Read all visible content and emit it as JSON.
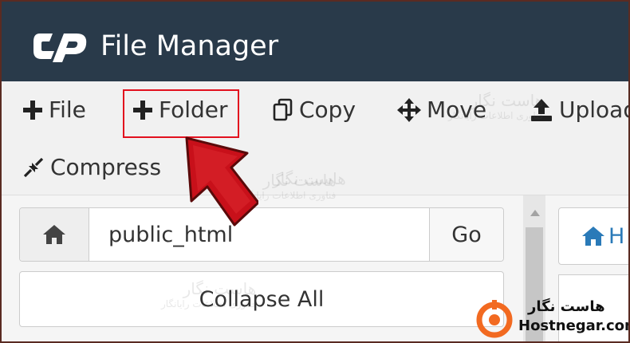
{
  "header": {
    "title": "File Manager",
    "logo_text": "cP"
  },
  "toolbar": {
    "items": [
      {
        "label": "File",
        "icon": "plus-icon"
      },
      {
        "label": "Folder",
        "icon": "plus-icon"
      },
      {
        "label": "Copy",
        "icon": "copy-icon"
      },
      {
        "label": "Move",
        "icon": "move-arrows-icon"
      },
      {
        "label": "Upload",
        "icon": "upload-icon"
      },
      {
        "label": "Compress",
        "icon": "compress-icon"
      }
    ]
  },
  "navigation": {
    "path_value": "public_html",
    "go_label": "Go",
    "collapse_label": "Collapse All",
    "home_crumb_label": "H"
  },
  "watermark": {
    "title_fa": "هاست نگار",
    "subtitle_fa": "فناوری اطلاعات رایانگار"
  },
  "branding": {
    "name_fa": "هاست نگار",
    "site": "Hostnegar.com"
  },
  "colors": {
    "header_bg": "#293a4a",
    "highlight": "#e2101e",
    "arrow": "#c8101a",
    "link_blue": "#2a7ab8",
    "brand_orange": "#f26a21"
  }
}
